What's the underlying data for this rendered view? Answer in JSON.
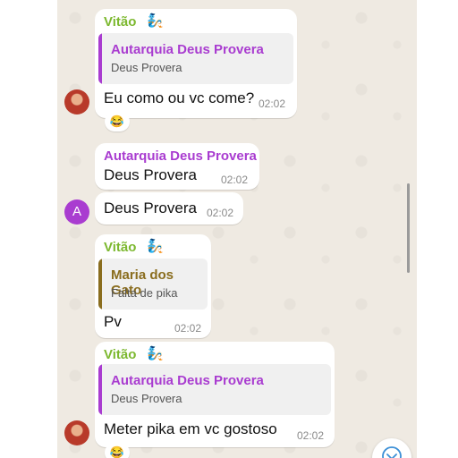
{
  "colors": {
    "chat_background": "#efeae2",
    "sender_green": "#7cb82f",
    "quote_purple": "#a93cd0",
    "quote_olive": "#8a6d1e",
    "avatar_purple": "#a93cd0"
  },
  "messages": [
    {
      "sender": "Vitão",
      "sender_emoji": "🧞",
      "quote": {
        "name": "Autarquia Deus Provera",
        "text": "Deus Provera"
      },
      "text": "Eu como ou vc come?",
      "time": "02:02",
      "reaction": "😂"
    },
    {
      "sender": "Autarquia Deus Provera",
      "text": "Deus Provera",
      "time": "02:02"
    },
    {
      "avatar_letter": "A",
      "text": "Deus Provera",
      "time": "02:02"
    },
    {
      "sender": "Vitão",
      "sender_emoji": "🧞",
      "quote": {
        "name": "Maria dos Gato",
        "text": "Falta de pika"
      },
      "text": "Pv",
      "time": "02:02"
    },
    {
      "sender": "Vitão",
      "sender_emoji": "🧞",
      "quote": {
        "name": "Autarquia Deus Provera",
        "text": "Deus Provera"
      },
      "text": "Meter pika em vc gostoso",
      "time": "02:02",
      "reaction": "😂"
    }
  ],
  "scroll_button_icon": "chevron-down-icon"
}
